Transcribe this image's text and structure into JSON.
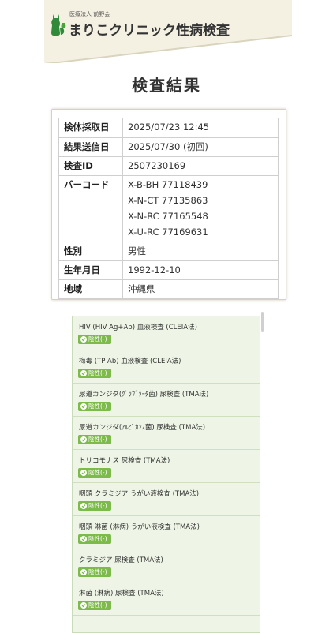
{
  "header": {
    "org_name": "医療法人 前野会",
    "clinic_name": "まりこクリニック性病検査",
    "logo_icon": "cat-silhouette-icon"
  },
  "page_title": "検査結果",
  "info": {
    "rows": [
      {
        "label": "検体採取日",
        "value": "2025/07/23  12:45"
      },
      {
        "label": "結果送信日",
        "value": "2025/07/30 (初回)"
      },
      {
        "label": "検査ID",
        "value": "2507230169"
      },
      {
        "label": "バーコード",
        "values": [
          "X-B-BH  77118439",
          "X-N-CT  77135863",
          "X-N-RC  77165548",
          "X-U-RC  77169631"
        ]
      },
      {
        "label": "性別",
        "value": "男性"
      },
      {
        "label": "生年月日",
        "value": "1992-12-10"
      },
      {
        "label": "地域",
        "value": "沖縄県"
      }
    ]
  },
  "results": [
    {
      "name": "HIV (HIV Ag+Ab) 血液検査 (CLEIA法)",
      "status": "陰性(-)"
    },
    {
      "name": "梅毒 (TP Ab) 血液検査 (CLEIA法)",
      "status": "陰性(-)"
    },
    {
      "name": "尿道カンジダ(ｸﾞﾗﾌﾞﾗｰﾀ菌) 尿検査 (TMA法)",
      "status": "陰性(-)"
    },
    {
      "name": "尿道カンジダ(ｱﾙﾋﾞｶﾝｽ菌) 尿検査 (TMA法)",
      "status": "陰性(-)"
    },
    {
      "name": "トリコモナス  尿検査 (TMA法)",
      "status": "陰性(-)"
    },
    {
      "name": "咽頭  クラミジア  うがい液検査 (TMA法)",
      "status": "陰性(-)"
    },
    {
      "name": "咽頭  淋菌 (淋病)   うがい液検査 (TMA法)",
      "status": "陰性(-)"
    },
    {
      "name": "クラミジア  尿検査 (TMA法)",
      "status": "陰性(-)"
    },
    {
      "name": "淋菌 (淋病)   尿検査 (TMA法)",
      "status": "陰性(-)"
    }
  ],
  "colors": {
    "header_band": "#f4f1e2",
    "accent_green": "#2f8a3a",
    "badge_green": "#7cba4a",
    "result_bg": "#eef5e6"
  }
}
